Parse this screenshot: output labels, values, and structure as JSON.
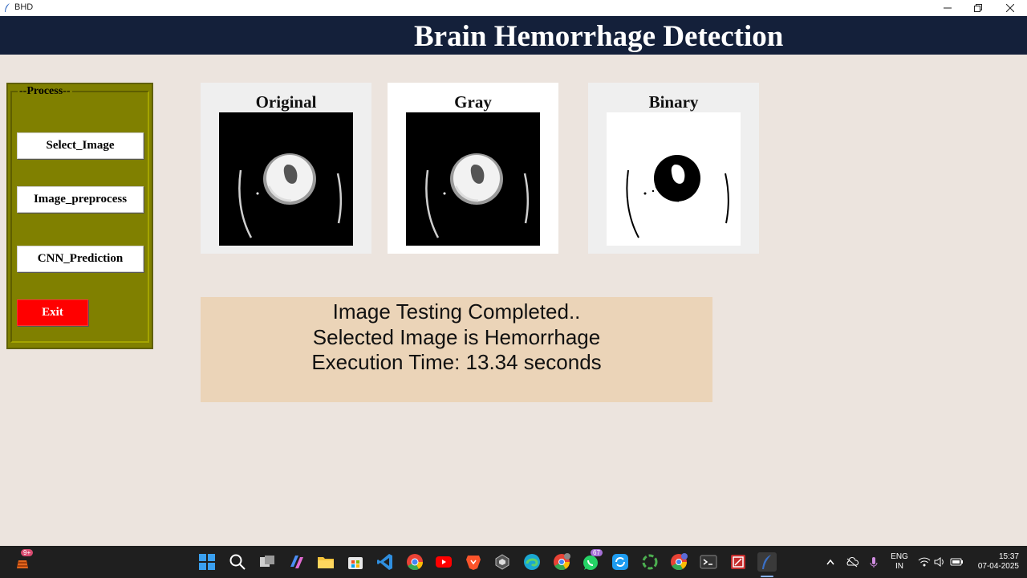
{
  "window": {
    "title": "BHD"
  },
  "header": {
    "title": "Brain Hemorrhage Detection"
  },
  "process": {
    "legend": "--Process--",
    "buttons": {
      "select": "Select_Image",
      "preprocess": "Image_preprocess",
      "predict": "CNN_Prediction",
      "exit": "Exit"
    }
  },
  "panels": {
    "original": "Original",
    "gray": "Gray",
    "binary": "Binary"
  },
  "result": {
    "line1": "Image Testing Completed..",
    "line2": "Selected Image is Hemorrhage",
    "line3": "Execution Time: 13.34 seconds"
  },
  "colors": {
    "header_bg": "#14203a",
    "process_bg": "#808000",
    "exit_bg": "#ff0000",
    "result_bg": "#ebd4b8",
    "window_bg": "#ece4de"
  },
  "taskbar": {
    "badges": {
      "widgets": "9+",
      "whatsapp": "67"
    },
    "language": "ENG",
    "region": "IN",
    "time": "15:37",
    "date": "07-04-2025",
    "icons": [
      "widgets-icon",
      "start-icon",
      "search-icon",
      "task-view-icon",
      "copilot-icon",
      "file-explorer-icon",
      "store-icon",
      "vscode-icon",
      "chrome-icon",
      "youtube-icon",
      "brave-icon",
      "app-icon",
      "edge-icon",
      "chrome-profile-icon",
      "whatsapp-icon",
      "sync-icon",
      "spinner-app-icon",
      "chrome-profile-icon-2",
      "terminal-icon",
      "archive-icon",
      "feather-app-icon"
    ]
  }
}
